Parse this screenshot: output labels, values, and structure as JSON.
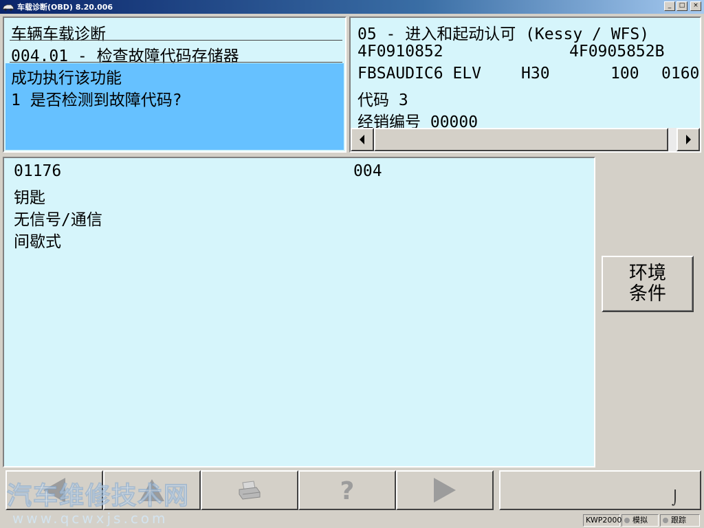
{
  "window": {
    "title": "车载诊断(OBD) 8.20.006",
    "buttons": {
      "minimize": "_",
      "maximize": "□",
      "close": "×"
    }
  },
  "left_panel": {
    "title": "车辆车载诊断",
    "function": "004.01 - 检查故障代码存储器",
    "status": "成功执行该功能",
    "question": "1 是否检测到故障代码?"
  },
  "right_panel": {
    "module": "05 - 进入和起动认可 (Kessy / WFS)",
    "part_no_1": "4F0910852",
    "part_no_2": "4F0905852B",
    "component": "FBSAUDIC6 ELV",
    "hw": "H30",
    "sw": "100",
    "tail": "0160",
    "coding": "代码 3",
    "dealer": "经销编号 00000"
  },
  "fault": {
    "code": "01176",
    "subcode": "004",
    "component": "钥匙",
    "type": "无信号/通信",
    "mode": "间歇式"
  },
  "env_button": {
    "line1": "环境",
    "line2": "条件"
  },
  "statusbar": {
    "protocol": "KWP2000",
    "simulate": "模拟",
    "trace": "跟踪"
  },
  "toolbar_grip": "⌡",
  "watermark": {
    "text": "汽车维修技术网",
    "url": "www.qcwxjs.com"
  },
  "icons": [
    "back-arrow-icon",
    "up-arrow-icon",
    "printer-icon",
    "help-icon",
    "forward-arrow-icon",
    "scroll-left-icon",
    "scroll-right-icon",
    "car-app-icon"
  ],
  "colors": {
    "panel_bg": "#d6f5fb",
    "highlight": "#66c1ff",
    "chrome": "#d4d0c8",
    "titlebar": "#0a246a"
  }
}
